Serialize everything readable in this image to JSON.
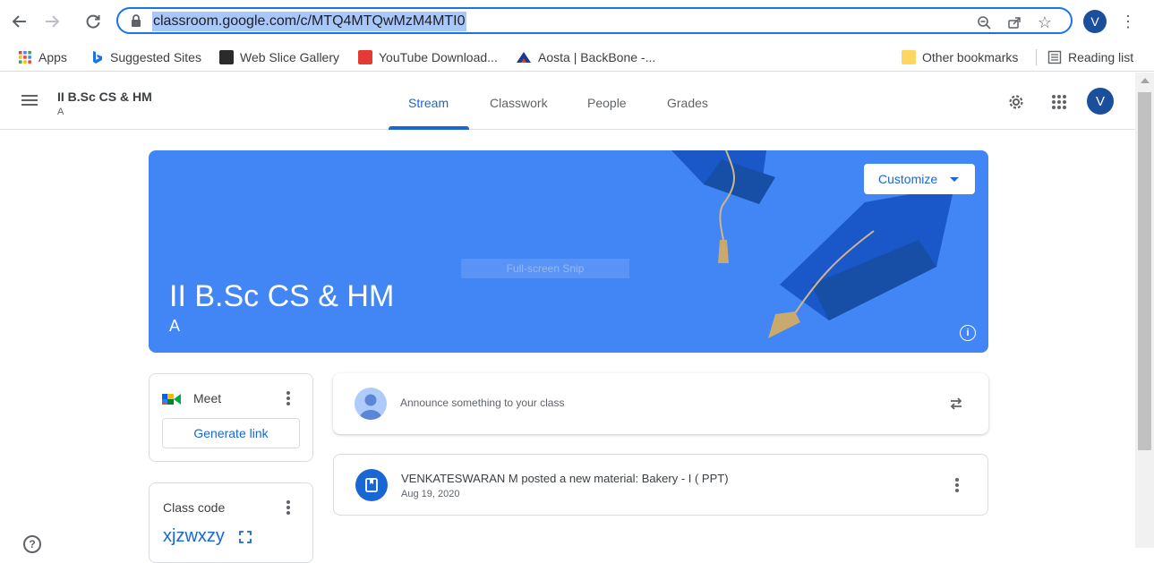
{
  "browser": {
    "url": "classroom.google.com/c/MTQ4MTQwMzM4MTI0",
    "profile_initial": "V",
    "bookmarks": [
      {
        "label": "Apps",
        "icon": "apps-grid-icon"
      },
      {
        "label": "Suggested Sites",
        "icon": "bing-icon"
      },
      {
        "label": "Web Slice Gallery",
        "icon": "web-slice-icon"
      },
      {
        "label": "YouTube Download...",
        "icon": "download-icon"
      },
      {
        "label": "Aosta | BackBone -...",
        "icon": "aosta-icon"
      }
    ],
    "other_bookmarks": "Other bookmarks",
    "reading_list": "Reading list"
  },
  "header": {
    "class_name": "II B.Sc CS & HM",
    "section": "A",
    "tabs": [
      {
        "label": "Stream",
        "active": true
      },
      {
        "label": "Classwork",
        "active": false
      },
      {
        "label": "People",
        "active": false
      },
      {
        "label": "Grades",
        "active": false
      }
    ],
    "avatar_initial": "V"
  },
  "banner": {
    "title": "II B.Sc CS & HM",
    "section": "A",
    "customize_label": "Customize",
    "overlay_text": "Full-screen Snip"
  },
  "meet": {
    "label": "Meet",
    "generate_label": "Generate link"
  },
  "class_code": {
    "label": "Class code",
    "value": "xjzwxzy"
  },
  "announce": {
    "placeholder": "Announce something to your class"
  },
  "posts": [
    {
      "title": "VENKATESWARAN M posted a new material: Bakery - I ( PPT)",
      "date": "Aug 19, 2020"
    }
  ],
  "colors": {
    "accent": "#1967d2",
    "banner": "#4285f4"
  }
}
